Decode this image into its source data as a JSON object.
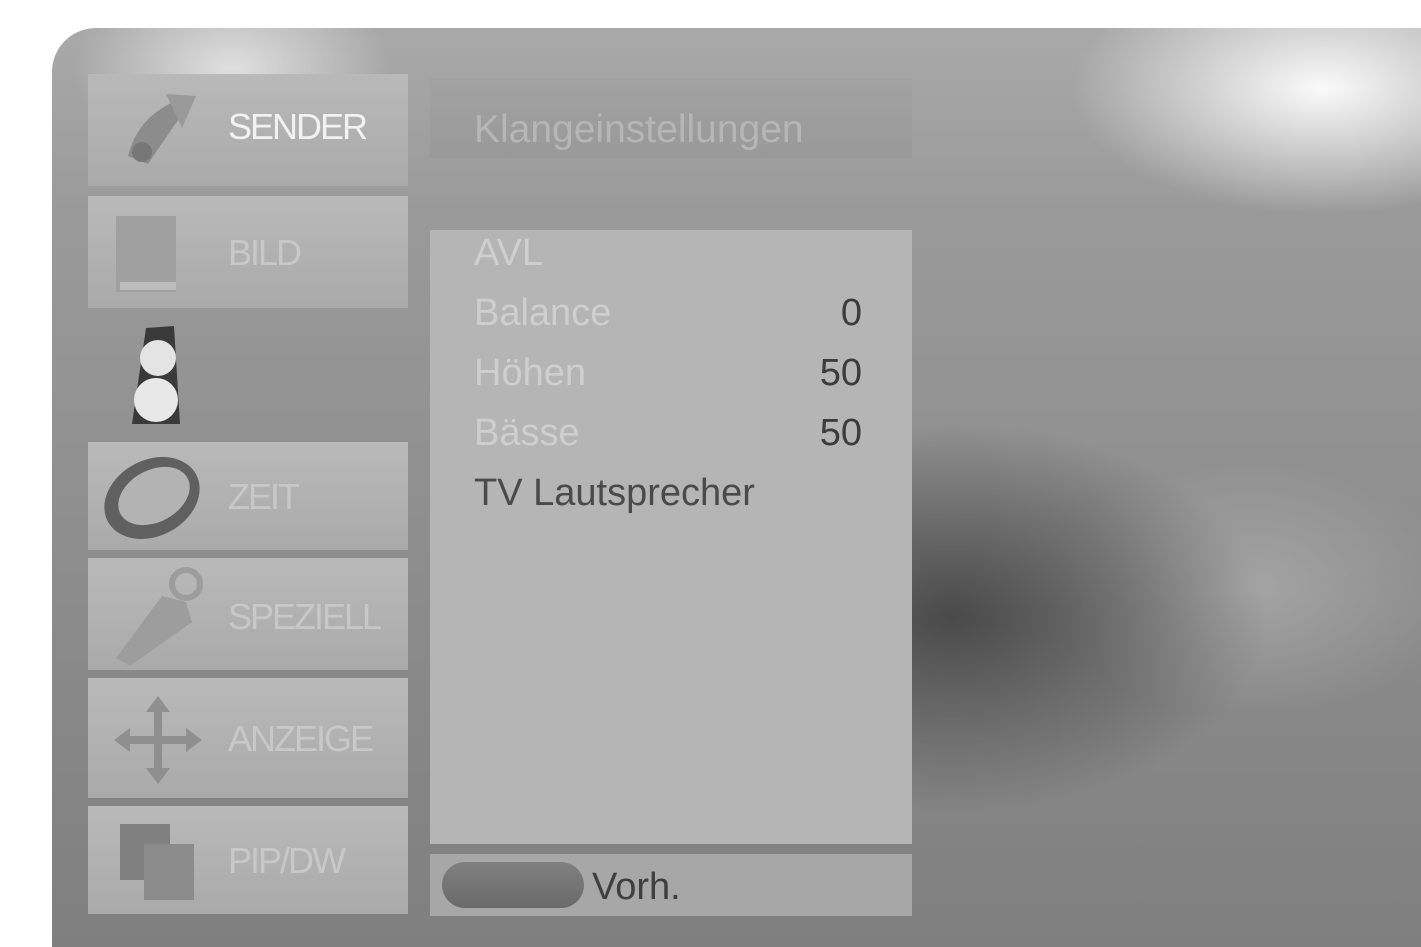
{
  "menu": {
    "items": [
      {
        "label": "SENDER",
        "icon": "satellite-dish-icon"
      },
      {
        "label": "BILD",
        "icon": "picture-icon"
      },
      {
        "label": "",
        "icon": "speaker-icon"
      },
      {
        "label": "ZEIT",
        "icon": "clock-icon"
      },
      {
        "label": "SPEZIELL",
        "icon": "tag-icon"
      },
      {
        "label": "ANZEIGE",
        "icon": "move-arrows-icon"
      },
      {
        "label": "PIP/DW",
        "icon": "pip-windows-icon"
      }
    ],
    "selected_index": 2
  },
  "panel": {
    "title": "Klangeinstellungen",
    "rows": [
      {
        "label": "AVL",
        "value": ""
      },
      {
        "label": "Balance",
        "value": "0"
      },
      {
        "label": "Höhen",
        "value": "50"
      },
      {
        "label": "Bässe",
        "value": "50"
      },
      {
        "label": "TV Lautsprecher",
        "value": ""
      }
    ],
    "active_row": "TV Lautsprecher"
  },
  "footer": {
    "button_label": "Vorh.",
    "button_color": "#6f6f6f"
  }
}
